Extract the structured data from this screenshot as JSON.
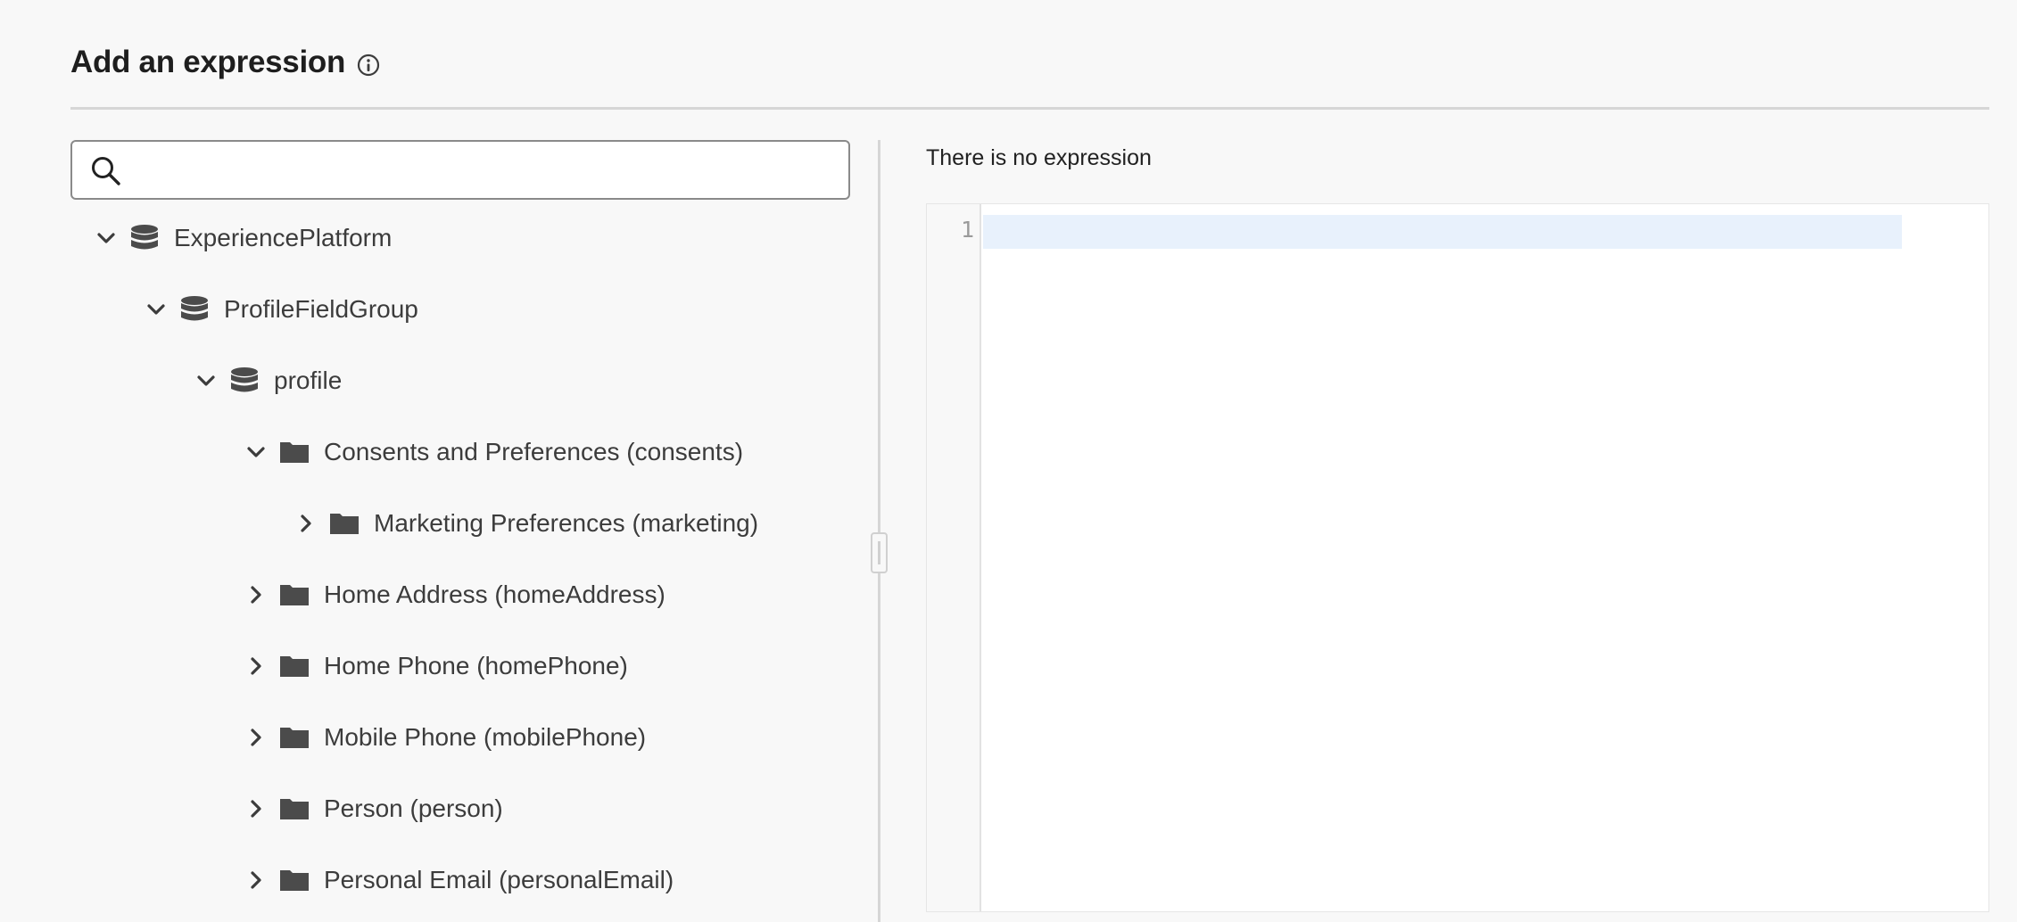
{
  "header": {
    "title": "Add an expression",
    "info_icon": "info-icon"
  },
  "search": {
    "value": "",
    "placeholder": "",
    "icon": "search-icon"
  },
  "tree": [
    {
      "label": "ExperiencePlatform",
      "expanded": true,
      "icon": "database-icon",
      "level": 0
    },
    {
      "label": "ProfileFieldGroup",
      "expanded": true,
      "icon": "database-icon",
      "level": 1
    },
    {
      "label": "profile",
      "expanded": true,
      "icon": "database-icon",
      "level": 2
    },
    {
      "label": "Consents and Preferences (consents)",
      "expanded": true,
      "icon": "folder-icon",
      "level": 3
    },
    {
      "label": "Marketing Preferences (marketing)",
      "expanded": false,
      "icon": "folder-icon",
      "level": 4
    },
    {
      "label": "Home Address (homeAddress)",
      "expanded": false,
      "icon": "folder-icon",
      "level": 3
    },
    {
      "label": "Home Phone (homePhone)",
      "expanded": false,
      "icon": "folder-icon",
      "level": 3
    },
    {
      "label": "Mobile Phone (mobilePhone)",
      "expanded": false,
      "icon": "folder-icon",
      "level": 3
    },
    {
      "label": "Person (person)",
      "expanded": false,
      "icon": "folder-icon",
      "level": 3
    },
    {
      "label": "Personal Email (personalEmail)",
      "expanded": false,
      "icon": "folder-icon",
      "level": 3
    }
  ],
  "editor": {
    "status": "There is no expression",
    "line_numbers": [
      "1"
    ],
    "content": ""
  },
  "colors": {
    "active_line": "#e8f1fc",
    "icon": "#4b4b4b"
  }
}
